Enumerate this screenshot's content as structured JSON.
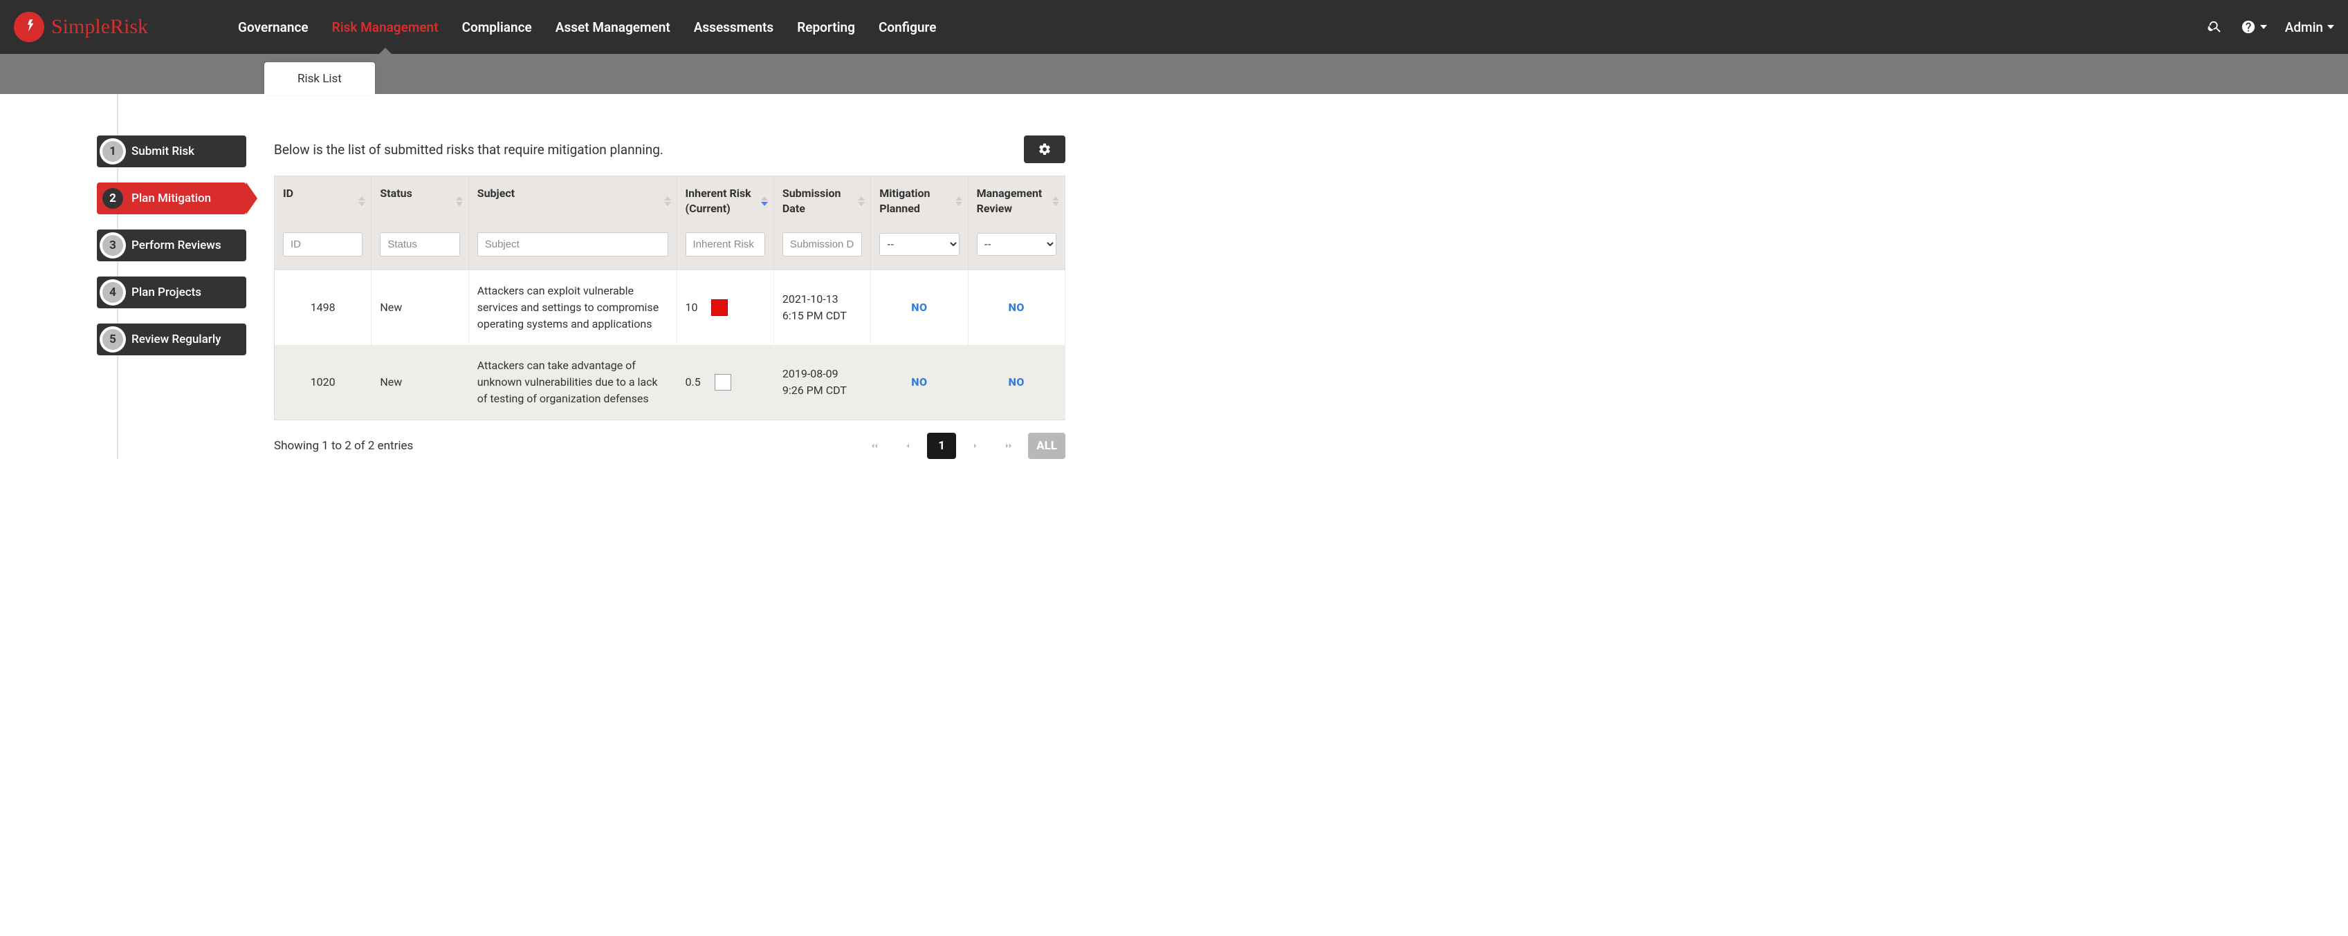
{
  "brand": {
    "name": "SimpleRisk"
  },
  "nav": {
    "items": [
      {
        "label": "Governance",
        "active": false
      },
      {
        "label": "Risk Management",
        "active": true
      },
      {
        "label": "Compliance",
        "active": false
      },
      {
        "label": "Asset Management",
        "active": false
      },
      {
        "label": "Assessments",
        "active": false
      },
      {
        "label": "Reporting",
        "active": false
      },
      {
        "label": "Configure",
        "active": false
      }
    ],
    "user": "Admin"
  },
  "subtabs": [
    {
      "label": "Risk List",
      "active": true
    }
  ],
  "steps": [
    {
      "num": "1",
      "label": "Submit Risk",
      "active": false
    },
    {
      "num": "2",
      "label": "Plan Mitigation",
      "active": true
    },
    {
      "num": "3",
      "label": "Perform Reviews",
      "active": false
    },
    {
      "num": "4",
      "label": "Plan Projects",
      "active": false
    },
    {
      "num": "5",
      "label": "Review Regularly",
      "active": false
    }
  ],
  "description": "Below is the list of submitted risks that require mitigation planning.",
  "table": {
    "columns": {
      "id": "ID",
      "status": "Status",
      "subject": "Subject",
      "risk": "Inherent Risk (Current)",
      "date": "Submission Date",
      "mit": "Mitigation Planned",
      "rev": "Management Review"
    },
    "filters": {
      "id_ph": "ID",
      "status_ph": "Status",
      "subject_ph": "Subject",
      "risk_ph": "Inherent Risk (Current)",
      "date_ph": "Submission Date",
      "mit_default": "--",
      "rev_default": "--"
    },
    "rows": [
      {
        "id": "1498",
        "status": "New",
        "subject": "Attackers can exploit vulnerable services and settings to compromise operating systems and applications",
        "risk_value": "10",
        "risk_color": "red",
        "date": "2021-10-13 6:15 PM CDT",
        "mit": "NO",
        "rev": "NO"
      },
      {
        "id": "1020",
        "status": "New",
        "subject": "Attackers can take advantage of unknown vulnerabilities due to a lack of testing of organization defenses",
        "risk_value": "0.5",
        "risk_color": "white",
        "date": "2019-08-09 9:26 PM CDT",
        "mit": "NO",
        "rev": "NO"
      }
    ]
  },
  "footer": {
    "info": "Showing 1 to 2 of 2 entries",
    "page": "1",
    "all": "ALL"
  }
}
